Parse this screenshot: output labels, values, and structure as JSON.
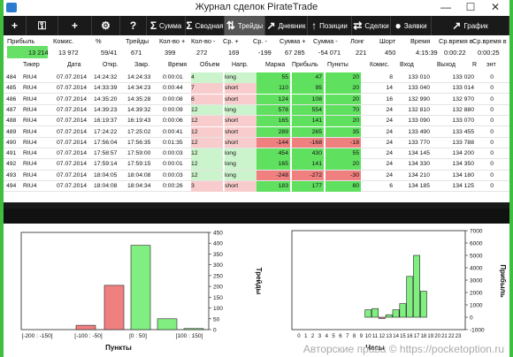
{
  "window": {
    "title": "Журнал сделок PirateTrade"
  },
  "toolbar": {
    "buttons": [
      {
        "icon": "+",
        "label": ""
      },
      {
        "icon": "⚿",
        "label": ""
      },
      {
        "icon": "+",
        "label": ""
      },
      {
        "icon": "⚙",
        "label": ""
      },
      {
        "icon": "?",
        "label": ""
      },
      {
        "icon": "Σ",
        "label": "Сумма"
      },
      {
        "icon": "Σ",
        "label": "Сводная"
      },
      {
        "icon": "⇅",
        "label": "Трейды"
      },
      {
        "icon": "↗",
        "label": "Дневник"
      },
      {
        "icon": "↑",
        "label": "Позиции"
      },
      {
        "icon": "⇄",
        "label": "Сделки"
      },
      {
        "icon": "●",
        "label": "Заявки"
      },
      {
        "icon": "↗",
        "label": "График"
      }
    ]
  },
  "stats": {
    "headers": [
      "Прибыль",
      "Комис.",
      "%",
      "Трейды",
      "Кол-во +",
      "Кол-во -",
      "Ср. +",
      "Ср. -",
      "Сумма +",
      "Сумма -",
      "Лонг",
      "Шорт",
      "Время",
      "Ср.время в",
      "Ср.время в"
    ],
    "values": [
      "13 214",
      "13 972",
      "59/41",
      "671",
      "399",
      "272",
      "169",
      "-199",
      "67 285",
      "-54 071",
      "221",
      "450",
      "4:15:39",
      "0:00:22",
      "0:00:25"
    ]
  },
  "grid": {
    "columns": [
      "Тикер",
      "Дата",
      "Откр.",
      "Закр.",
      "Время",
      "Объем",
      "Напр.",
      "Маржа",
      "Прибыль",
      "Пункты",
      "Комис.",
      "Вход",
      "Выход",
      "R",
      "энт"
    ],
    "rows": [
      [
        "484",
        "RIU4",
        "07.07.2014",
        "14:24:32",
        "14:24:33",
        "0:00:01",
        "4",
        "long",
        "55",
        "47",
        "20",
        "8",
        "133 010",
        "133 020",
        "0"
      ],
      [
        "485",
        "RIU4",
        "07.07.2014",
        "14:33:39",
        "14:34:23",
        "0:00:44",
        "7",
        "short",
        "110",
        "95",
        "20",
        "14",
        "133 040",
        "133 014",
        "0"
      ],
      [
        "486",
        "RIU4",
        "07.07.2014",
        "14:35:20",
        "14:35:28",
        "0:00:08",
        "8",
        "short",
        "124",
        "108",
        "20",
        "16",
        "132 990",
        "132 970",
        "0"
      ],
      [
        "487",
        "RIU4",
        "07.07.2014",
        "14:39:23",
        "14:39:32",
        "0:00:09",
        "12",
        "long",
        "578",
        "554",
        "70",
        "24",
        "132 810",
        "132 880",
        "0"
      ],
      [
        "488",
        "RIU4",
        "07.07.2014",
        "16:19:37",
        "16:19:43",
        "0:00:06",
        "12",
        "short",
        "165",
        "141",
        "20",
        "24",
        "133 090",
        "133 070",
        "0"
      ],
      [
        "489",
        "RIU4",
        "07.07.2014",
        "17:24:22",
        "17:25:02",
        "0:00:41",
        "12",
        "short",
        "289",
        "265",
        "35",
        "24",
        "133 490",
        "133 455",
        "0"
      ],
      [
        "490",
        "RIU4",
        "07.07.2014",
        "17:56:04",
        "17:56:35",
        "0:01:35",
        "12",
        "short",
        "-144",
        "-168",
        "-18",
        "24",
        "133 770",
        "133 788",
        "0"
      ],
      [
        "491",
        "RIU4",
        "07.07.2014",
        "17:58:57",
        "17:59:00",
        "0:00:03",
        "12",
        "long",
        "454",
        "430",
        "55",
        "24",
        "134 145",
        "134 200",
        "0"
      ],
      [
        "492",
        "RIU4",
        "07.07.2014",
        "17:59:14",
        "17:59:15",
        "0:00:01",
        "12",
        "long",
        "165",
        "141",
        "20",
        "24",
        "134 330",
        "134 350",
        "0"
      ],
      [
        "493",
        "RIU4",
        "07.07.2014",
        "18:04:05",
        "18:04:08",
        "0:00:03",
        "12",
        "long",
        "-248",
        "-272",
        "-30",
        "24",
        "134 210",
        "134 180",
        "0"
      ],
      [
        "494",
        "RIU4",
        "07.07.2014",
        "18:04:08",
        "18:04:34",
        "0:00:26",
        "3",
        "short",
        "183",
        "177",
        "60",
        "6",
        "134 185",
        "134 125",
        "0"
      ]
    ]
  },
  "chart_data": [
    {
      "type": "bar",
      "xlabel": "Пункты",
      "ylabel": "Трейды",
      "categories": [
        "[-200 : -150]",
        "[-100 : -50]",
        "[0 : 50]",
        "[100 : 150]"
      ],
      "bars": [
        {
          "bin": "[-100 : -50]",
          "value": 20,
          "sign": "neg"
        },
        {
          "bin": "[-50 : 0]",
          "value": 205,
          "sign": "neg"
        },
        {
          "bin": "[0 : 50]",
          "value": 390,
          "sign": "pos"
        },
        {
          "bin": "[50 : 100]",
          "value": 50,
          "sign": "pos"
        },
        {
          "bin": "[100 : 150]",
          "value": 5,
          "sign": "pos"
        }
      ],
      "ylim": [
        0,
        450
      ],
      "yticks": [
        0,
        50,
        100,
        150,
        200,
        250,
        300,
        350,
        400,
        450
      ],
      "colors": {
        "neg": "#f08080",
        "pos": "#80ee80"
      }
    },
    {
      "type": "bar",
      "xlabel": "Часы",
      "ylabel": "Прибыль",
      "categories": [
        "0",
        "1",
        "2",
        "3",
        "4",
        "5",
        "6",
        "7",
        "8",
        "9",
        "10",
        "11",
        "12",
        "13",
        "14",
        "15",
        "16",
        "17",
        "18",
        "19",
        "20",
        "21",
        "22",
        "23"
      ],
      "values": [
        0,
        0,
        0,
        0,
        0,
        0,
        0,
        0,
        0,
        0,
        600,
        700,
        -100,
        200,
        600,
        1100,
        3300,
        5000,
        2100,
        0,
        0,
        0,
        0,
        0
      ],
      "ylim": [
        -1000,
        7000
      ],
      "yticks": [
        -1000,
        0,
        1000,
        2000,
        3000,
        4000,
        5000,
        6000,
        7000
      ],
      "colors": {
        "pos": "#80ee80",
        "neg": "#f08080"
      }
    }
  ],
  "watermark": "Авторские права © https://pocketoption.ru"
}
